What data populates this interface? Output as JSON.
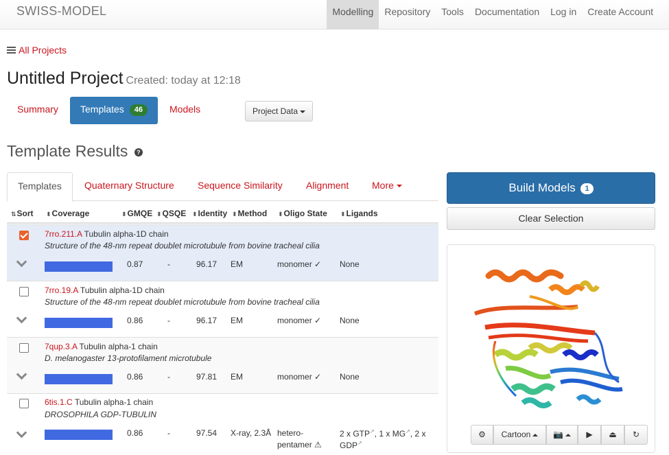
{
  "navbar": {
    "brand": "SWISS-MODEL",
    "items": [
      {
        "label": "Modelling",
        "active": true
      },
      {
        "label": "Repository"
      },
      {
        "label": "Tools"
      },
      {
        "label": "Documentation"
      },
      {
        "label": "Log in"
      },
      {
        "label": "Create Account"
      }
    ]
  },
  "breadcrumb": {
    "all_projects": "All Projects"
  },
  "project": {
    "title": "Untitled Project",
    "created": "Created: today at 12:18"
  },
  "project_tabs": {
    "summary": "Summary",
    "templates": "Templates",
    "templates_count": "46",
    "models": "Models",
    "project_data": "Project Data"
  },
  "section": {
    "title": "Template Results",
    "help_icon": "question-circle-icon"
  },
  "result_tabs": {
    "templates": "Templates",
    "quaternary": "Quaternary Structure",
    "similarity": "Sequence Similarity",
    "alignment": "Alignment",
    "more": "More"
  },
  "table": {
    "headers": {
      "sort": "Sort",
      "coverage": "Coverage",
      "gmqe": "GMQE",
      "qsqe": "QSQE",
      "identity": "Identity",
      "method": "Method",
      "oligo": "Oligo State",
      "ligands": "Ligands"
    },
    "rows": [
      {
        "id": "7rro.211.A",
        "name": "Tubulin alpha-1D chain",
        "desc": "Structure of the 48-nm repeat doublet microtubule from bovine tracheal cilia",
        "gmqe": "0.87",
        "qsqe": "-",
        "identity": "96.17",
        "method": "EM",
        "oligo": "monomer ✓",
        "ligands": "None",
        "selected": true
      },
      {
        "id": "7rro.19.A",
        "name": "Tubulin alpha-1D chain",
        "desc": "Structure of the 48-nm repeat doublet microtubule from bovine tracheal cilia",
        "gmqe": "0.86",
        "qsqe": "-",
        "identity": "96.17",
        "method": "EM",
        "oligo": "monomer ✓",
        "ligands": "None",
        "selected": false
      },
      {
        "id": "7qup.3.A",
        "name": "Tubulin alpha-1 chain",
        "desc": "D. melanogaster 13-protofilament microtubule",
        "gmqe": "0.86",
        "qsqe": "-",
        "identity": "97.81",
        "method": "EM",
        "oligo": "monomer ✓",
        "ligands": "None",
        "selected": false
      },
      {
        "id": "6tis.1.C",
        "name": "Tubulin alpha-1 chain",
        "desc": "DROSOPHILA GDP-TUBULIN",
        "gmqe": "0.86",
        "qsqe": "-",
        "identity": "97.54",
        "method": "X-ray, 2.3Å",
        "oligo_line1": "hetero-",
        "oligo_line2": "pentamer ⚠",
        "lig_a": "2 x GTP",
        "lig_b": ", 1 x MG",
        "lig_c": ", 2 x",
        "lig_d": "GDP",
        "selected": false
      }
    ]
  },
  "right_panel": {
    "build_models": "Build Models",
    "build_count": "1",
    "clear_selection": "Clear Selection",
    "viewer": {
      "style": "Cartoon"
    }
  },
  "colors": {
    "accent": "#c9161e",
    "primary": "#337ab7",
    "coverage_bar": "#4169e1"
  }
}
